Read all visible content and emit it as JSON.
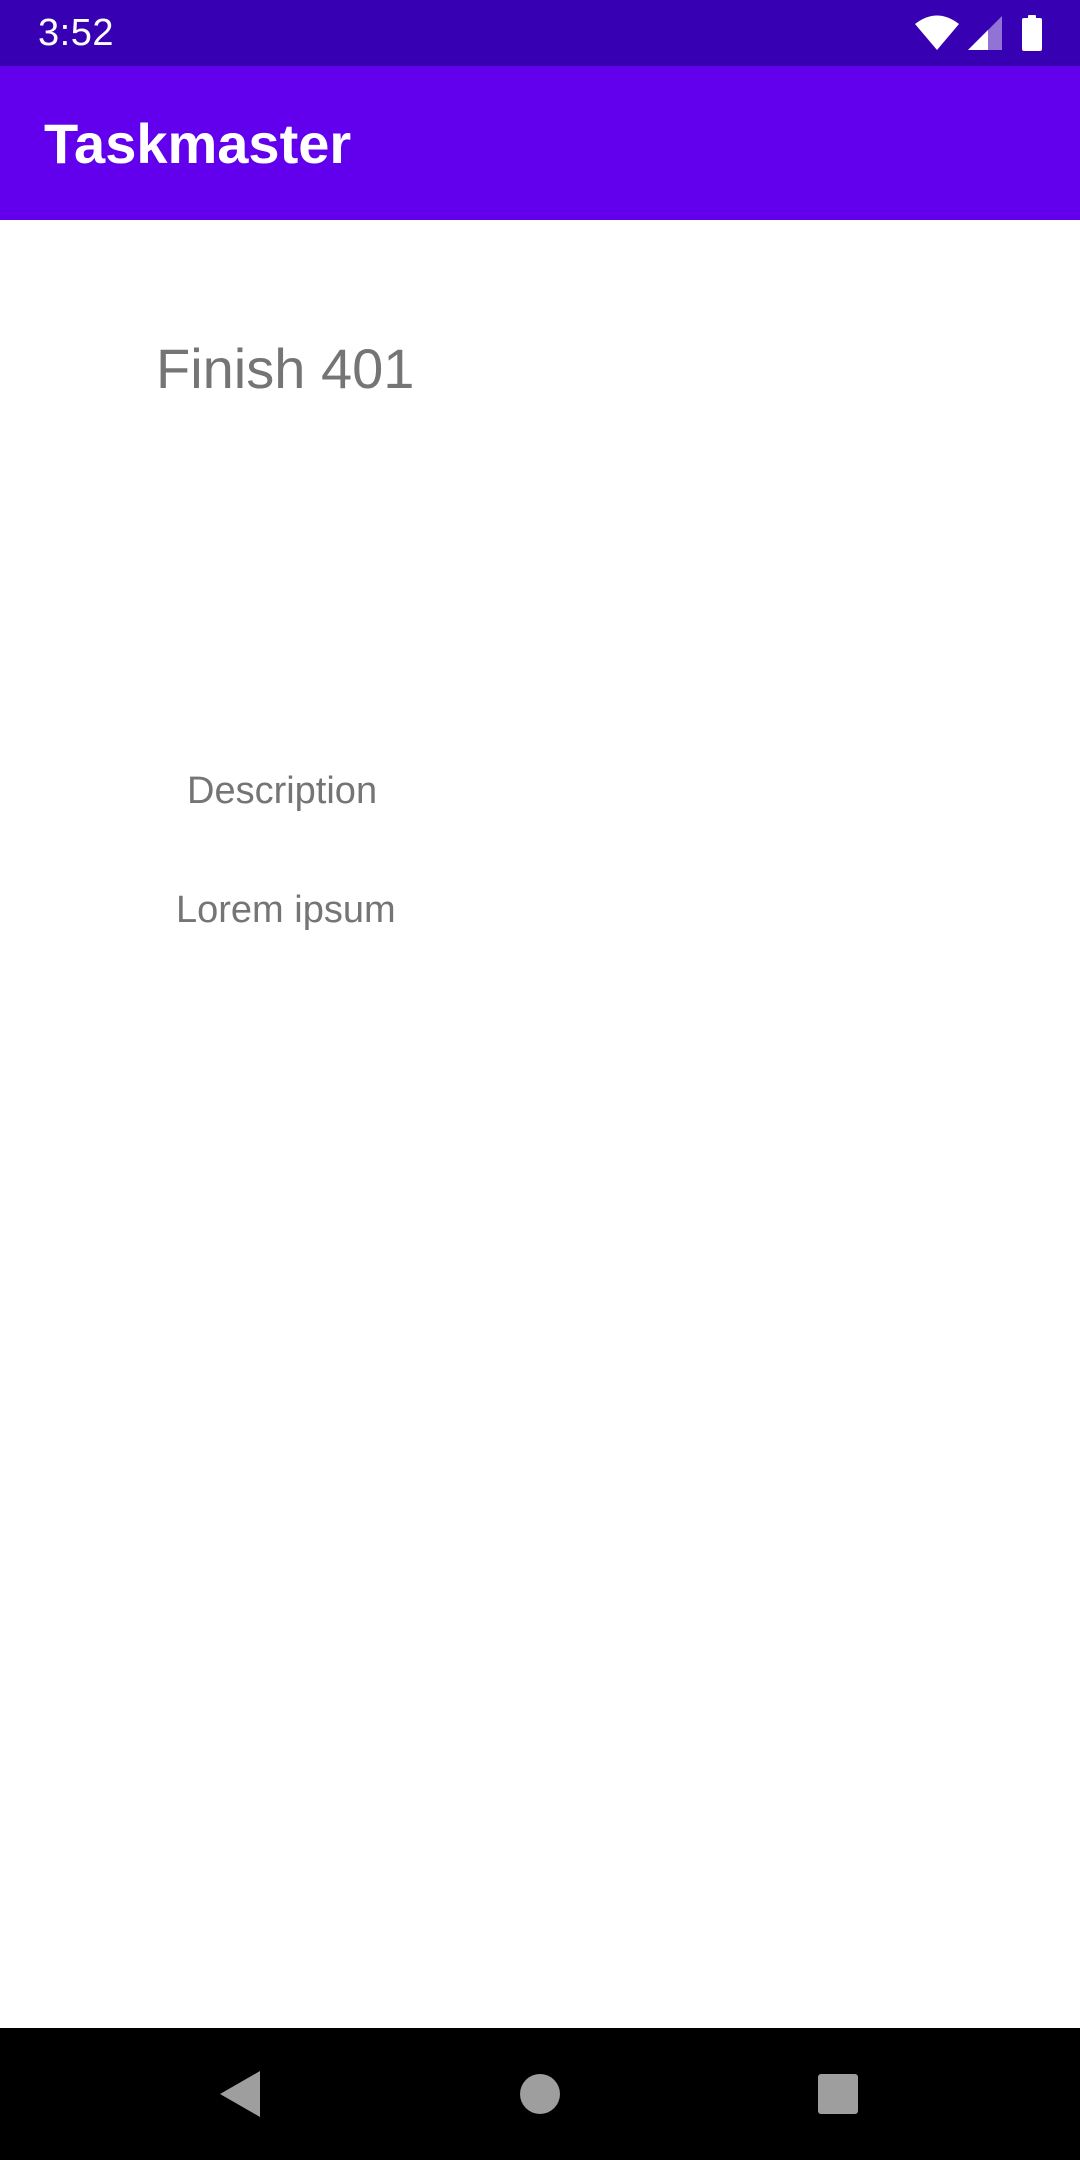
{
  "status_bar": {
    "time": "3:52",
    "icons": [
      "wifi-icon",
      "cell-signal-icon",
      "battery-icon"
    ]
  },
  "app_bar": {
    "title": "Taskmaster"
  },
  "task_detail": {
    "title": "Finish 401",
    "description_label": "Description",
    "description_body": "Lorem ipsum"
  },
  "nav_bar": {
    "buttons": [
      "back-icon",
      "home-icon",
      "recents-icon"
    ]
  },
  "colors": {
    "status_bar": "#3700B3",
    "app_bar": "#6200EE",
    "text_secondary": "#757575",
    "background": "#FFFFFF",
    "nav_bar": "#000000"
  }
}
